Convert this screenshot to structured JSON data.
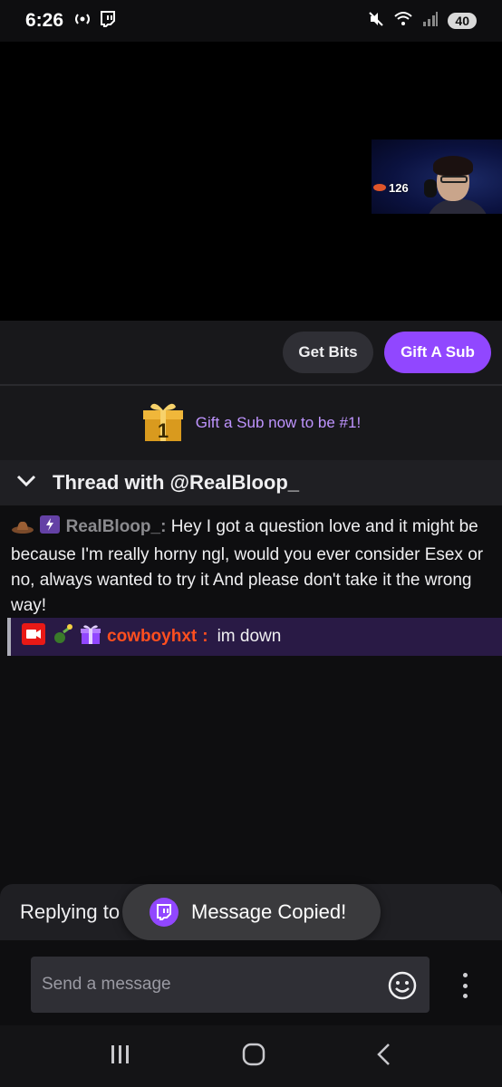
{
  "status_bar": {
    "time": "6:26",
    "battery": "40"
  },
  "stream": {
    "viewer_count": "126"
  },
  "actions": {
    "get_bits": "Get Bits",
    "gift_sub": "Gift A Sub"
  },
  "gift_banner": {
    "text": "Gift a Sub now to be #1!",
    "badge_number": "1"
  },
  "thread": {
    "title": "Thread with @RealBloop_"
  },
  "chat": {
    "message": {
      "username": "RealBloop_",
      "separator": ":",
      "text": " Hey I got a question love and it might be because I'm really horny ngl, would you ever consider Esex or no, always wanted to try it And please don't take it the wrong way!"
    },
    "reply": {
      "username": "cowboyhxt",
      "separator": ":",
      "text": "im down"
    }
  },
  "reply_bar": {
    "text": "Replying to @cowboyhxt"
  },
  "toast": {
    "text": "Message Copied!"
  },
  "input": {
    "placeholder": "Send a message"
  },
  "colors": {
    "accent": "#9147ff",
    "accent_text": "#bf94ff",
    "reply_bg": "#291a45",
    "username_reply": "#ff4f1f",
    "username_original": "#8a8a8e"
  },
  "icons": {
    "status_left": [
      "broadcast-icon",
      "twitch-icon"
    ],
    "status_right": [
      "mute-icon",
      "wifi-icon",
      "signal-icon"
    ],
    "viewer": "flame-viewer-icon",
    "thread": "chevron-down-icon",
    "badges_original": [
      "cowboy-hat-badge-icon",
      "prime-badge-icon"
    ],
    "badges_reply": [
      "broadcaster-badge-icon",
      "vip-badge-icon",
      "sub-gifter-badge-icon"
    ],
    "toast": "twitch-logo-icon",
    "input_emote": "emote-smile-icon",
    "input_more": "more-vertical-icon",
    "nav": [
      "recent-apps-icon",
      "home-icon",
      "back-icon"
    ]
  }
}
